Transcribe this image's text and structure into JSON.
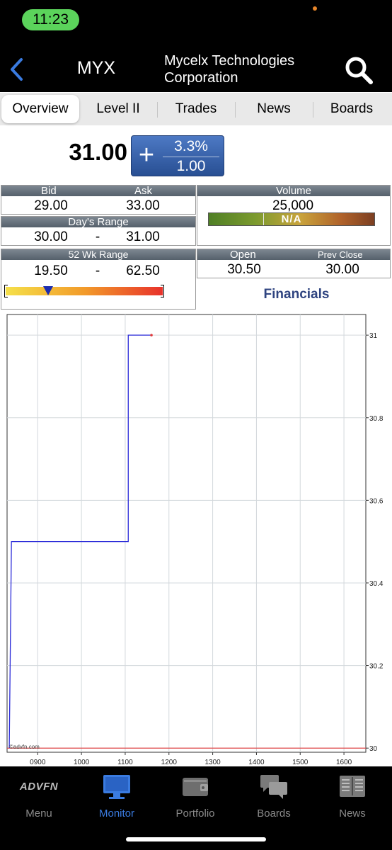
{
  "status_bar": {
    "time": "11:23"
  },
  "header": {
    "symbol": "MYX",
    "company_line1": "Mycelx Technologies",
    "company_line2": "Corporation"
  },
  "tabs": [
    {
      "label": "Overview",
      "active": true
    },
    {
      "label": "Level II",
      "active": false
    },
    {
      "label": "Trades",
      "active": false
    },
    {
      "label": "News",
      "active": false
    },
    {
      "label": "Boards",
      "active": false
    }
  ],
  "quote": {
    "price": "31.00",
    "change_sign": "+",
    "change_percent": "3.3%",
    "change_value": "1.00",
    "bid_label": "Bid",
    "bid": "29.00",
    "ask_label": "Ask",
    "ask": "33.00",
    "days_range_label": "Day's Range",
    "days_low": "30.00",
    "days_range_sep": "-",
    "days_high": "31.00",
    "volume_label": "Volume",
    "volume": "25,000",
    "volume_bar_text": "N/A",
    "wk52_label": "52 Wk Range",
    "wk52_low": "19.50",
    "wk52_sep": "-",
    "wk52_high": "62.50",
    "wk52_position": 0.27,
    "open_label": "Open",
    "open": "30.50",
    "prev_close_label": "Prev Close",
    "prev_close": "30.00",
    "financials_link": "Financials"
  },
  "chart_data": {
    "type": "line",
    "x_ticks": [
      "0900",
      "1000",
      "1100",
      "1200",
      "1300",
      "1400",
      "1500",
      "1600"
    ],
    "y_ticks": [
      30,
      30.2,
      30.4,
      30.6,
      30.8,
      31
    ],
    "ylim": [
      29.99,
      31.05
    ],
    "xlim": [
      8.3,
      16.5
    ],
    "series": [
      {
        "color": "#2a2ad8",
        "points": [
          {
            "x": 8.35,
            "y": 30.0
          },
          {
            "x": 8.4,
            "y": 30.5
          },
          {
            "x": 11.07,
            "y": 30.5
          },
          {
            "x": 11.07,
            "y": 31.0
          },
          {
            "x": 11.6,
            "y": 31.0
          }
        ]
      }
    ],
    "reference_line": {
      "y": 30.0,
      "color": "#e03a3a"
    },
    "watermark": "©advfn.com",
    "grid": true
  },
  "bottom_nav": [
    {
      "label": "Menu",
      "icon": "advfn-logo-icon",
      "logo_text": "ADVFN",
      "active": false
    },
    {
      "label": "Monitor",
      "icon": "monitor-icon",
      "active": true
    },
    {
      "label": "Portfolio",
      "icon": "wallet-icon",
      "active": false
    },
    {
      "label": "Boards",
      "icon": "chat-bubbles-icon",
      "active": false
    },
    {
      "label": "News",
      "icon": "newspaper-icon",
      "active": false
    }
  ],
  "colors": {
    "accent": "#3a7be0",
    "change_box": "#3a65ad",
    "status_pill": "#5bd35b",
    "price_line": "#2a2ad8",
    "reference_line": "#e03a3a"
  }
}
